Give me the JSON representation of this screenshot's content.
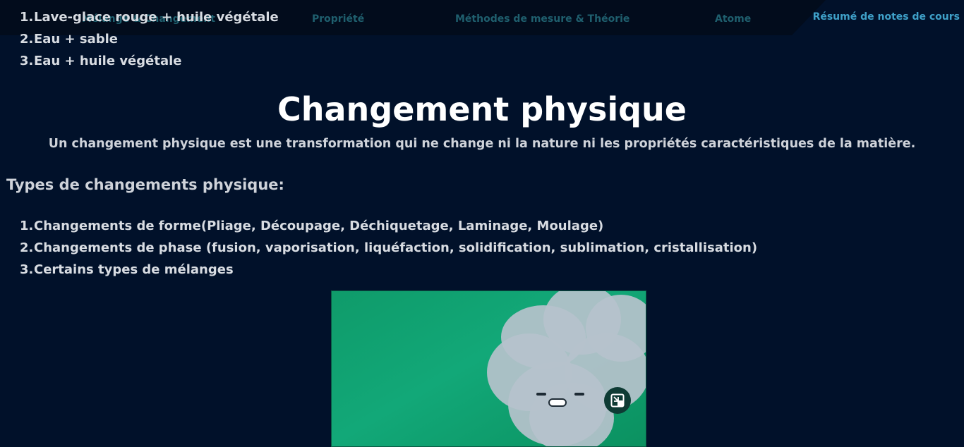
{
  "nav": {
    "items": [
      "Mélange & Changement",
      "Propriété",
      "Méthodes de mesure & Théorie",
      "Atome"
    ],
    "active": "Résumé de notes de cours"
  },
  "top_list": [
    {
      "num": "1",
      "text": "Lave-glace rouge + huile végétale"
    },
    {
      "num": "2",
      "text": "Eau + sable"
    },
    {
      "num": "3",
      "text": "Eau + huile végétale"
    }
  ],
  "heading": "Changement physique",
  "definition": "Un changement physique est une transformation qui ne change ni la nature ni les propriétés caractéristiques de la matière.",
  "types_heading": "Types de changements physique:",
  "types_list": [
    {
      "num": "1",
      "text": "Changements de forme(Pliage, Découpage, Déchiquetage, Laminage, Moulage)"
    },
    {
      "num": "2",
      "text": "Changements de phase (fusion, vaporisation, liquéfaction, solidification, sublimation, cristallisation)"
    },
    {
      "num": "3",
      "text": "Certains types de mélanges"
    }
  ],
  "video": {
    "pip_icon": "picture-in-picture-icon",
    "background_color": "#12a878"
  }
}
